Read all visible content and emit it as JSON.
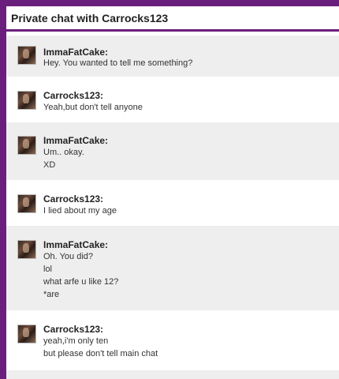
{
  "chat": {
    "title": "Private chat with Carrocks123",
    "messages": [
      {
        "author": "ImmaFatCake:",
        "lines": [
          "Hey. You wanted to tell me something?"
        ]
      },
      {
        "author": "Carrocks123:",
        "lines": [
          "Yeah,but don't tell anyone"
        ]
      },
      {
        "author": "ImmaFatCake:",
        "lines": [
          "Um.. okay.",
          "XD"
        ]
      },
      {
        "author": "Carrocks123:",
        "lines": [
          "I lied about my age"
        ]
      },
      {
        "author": "ImmaFatCake:",
        "lines": [
          "Oh. You did?",
          "lol",
          "what arfe u like 12?",
          "*are"
        ]
      },
      {
        "author": "Carrocks123:",
        "lines": [
          "yeah,i'm only ten",
          "but please don't tell main chat"
        ]
      }
    ]
  }
}
